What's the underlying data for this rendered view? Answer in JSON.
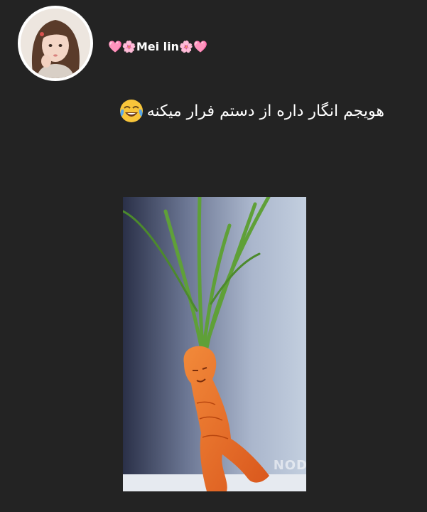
{
  "post": {
    "username": "🩷🌸Mei lin🌸🩷",
    "caption_text": "هویجم انگار داره از دستم فرار میکنه",
    "caption_emoji": "face-with-tears-of-joy",
    "photo_watermark": "NOD"
  },
  "colors": {
    "background": "#232323",
    "text": "#ffffff",
    "avatar_ring": "#ffffff"
  }
}
